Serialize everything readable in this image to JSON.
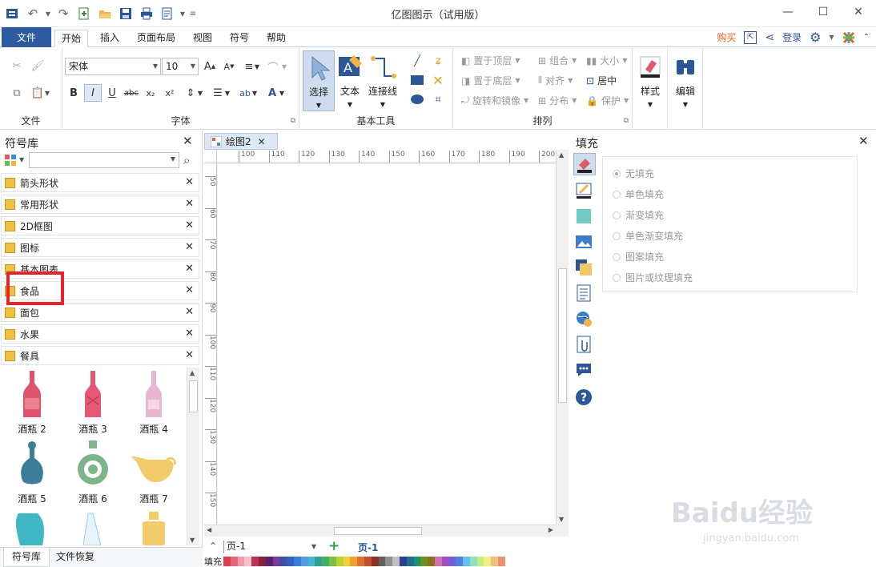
{
  "app": {
    "title": "亿图图示（试用版）"
  },
  "menu": {
    "file": "文件",
    "tabs": [
      "开始",
      "插入",
      "页面布局",
      "视图",
      "符号",
      "帮助"
    ],
    "buy": "购买",
    "login": "登录"
  },
  "ribbon": {
    "file_group": "文件",
    "font_group": "字体",
    "font_name": "宋体",
    "font_size": "10",
    "tools_group": "基本工具",
    "select": "选择",
    "text": "文本",
    "connector": "连接线",
    "arrange_group": "排列",
    "bring_front": "置于顶层",
    "send_back": "置于底层",
    "rotate_mirror": "旋转和镜像",
    "group": "组合",
    "align": "对齐",
    "distribute": "分布",
    "size": "大小",
    "center": "居中",
    "protect": "保护",
    "style": "样式",
    "edit": "编辑"
  },
  "library": {
    "title": "符号库",
    "categories": [
      "箭头形状",
      "常用形状",
      "2D框图",
      "图标",
      "基本图表",
      "食品",
      "面包",
      "水果",
      "餐具"
    ],
    "shapes": [
      {
        "label": "酒瓶 2",
        "icon": "wine-bottle-icon",
        "color": "#e0536c"
      },
      {
        "label": "酒瓶 3",
        "icon": "wine-bottle-icon",
        "color": "#e45775"
      },
      {
        "label": "酒瓶 4",
        "icon": "wine-bottle-icon",
        "color": "#e8b6cf"
      },
      {
        "label": "酒瓶 5",
        "icon": "decanter-icon",
        "color": "#3e7d9a"
      },
      {
        "label": "酒瓶 6",
        "icon": "round-bottle-icon",
        "color": "#7cb58a"
      },
      {
        "label": "酒瓶 7",
        "icon": "gravy-boat-icon",
        "color": "#f2cb6a"
      }
    ],
    "tabs": [
      "符号库",
      "文件恢复"
    ]
  },
  "document": {
    "tab": "绘图2",
    "page_label": "页-1",
    "page_tab": "页-1",
    "fill_label": "填充",
    "ruler_top": [
      "100",
      "110",
      "120",
      "130",
      "140",
      "150",
      "160",
      "170",
      "180",
      "190",
      "200"
    ],
    "ruler_left": [
      "50",
      "60",
      "70",
      "80",
      "90",
      "100",
      "110",
      "120",
      "130",
      "140",
      "150",
      "160"
    ]
  },
  "fill": {
    "title": "填充",
    "options": [
      "无填充",
      "单色填充",
      "渐变填充",
      "单色渐变填充",
      "图案填充",
      "图片或纹理填充"
    ],
    "selected": "无填充"
  },
  "palette": [
    "#e03c4c",
    "#e8667a",
    "#f09aa8",
    "#f5c2cb",
    "#c03050",
    "#8a2040",
    "#5a1f6e",
    "#7a3a9a",
    "#4050a0",
    "#3060c0",
    "#3a7dd0",
    "#50a0e0",
    "#40b8d8",
    "#30a090",
    "#40b060",
    "#80c040",
    "#c0d030",
    "#f0d040",
    "#f0a030",
    "#e07030",
    "#c05030",
    "#903020",
    "#606060",
    "#909090",
    "#c0c0c0",
    "#2f3f8f",
    "#1f6f8f",
    "#1f8f6f",
    "#6f8f1f",
    "#8f6f1f",
    "#d070b0",
    "#a050c0",
    "#7060d0",
    "#5080e0",
    "#60c0f0",
    "#90e0c0",
    "#c0f080",
    "#f0f080",
    "#f0c080",
    "#f09070"
  ],
  "watermark": {
    "text": "Baidu经验",
    "sub": "jingyan.baidu.com"
  }
}
